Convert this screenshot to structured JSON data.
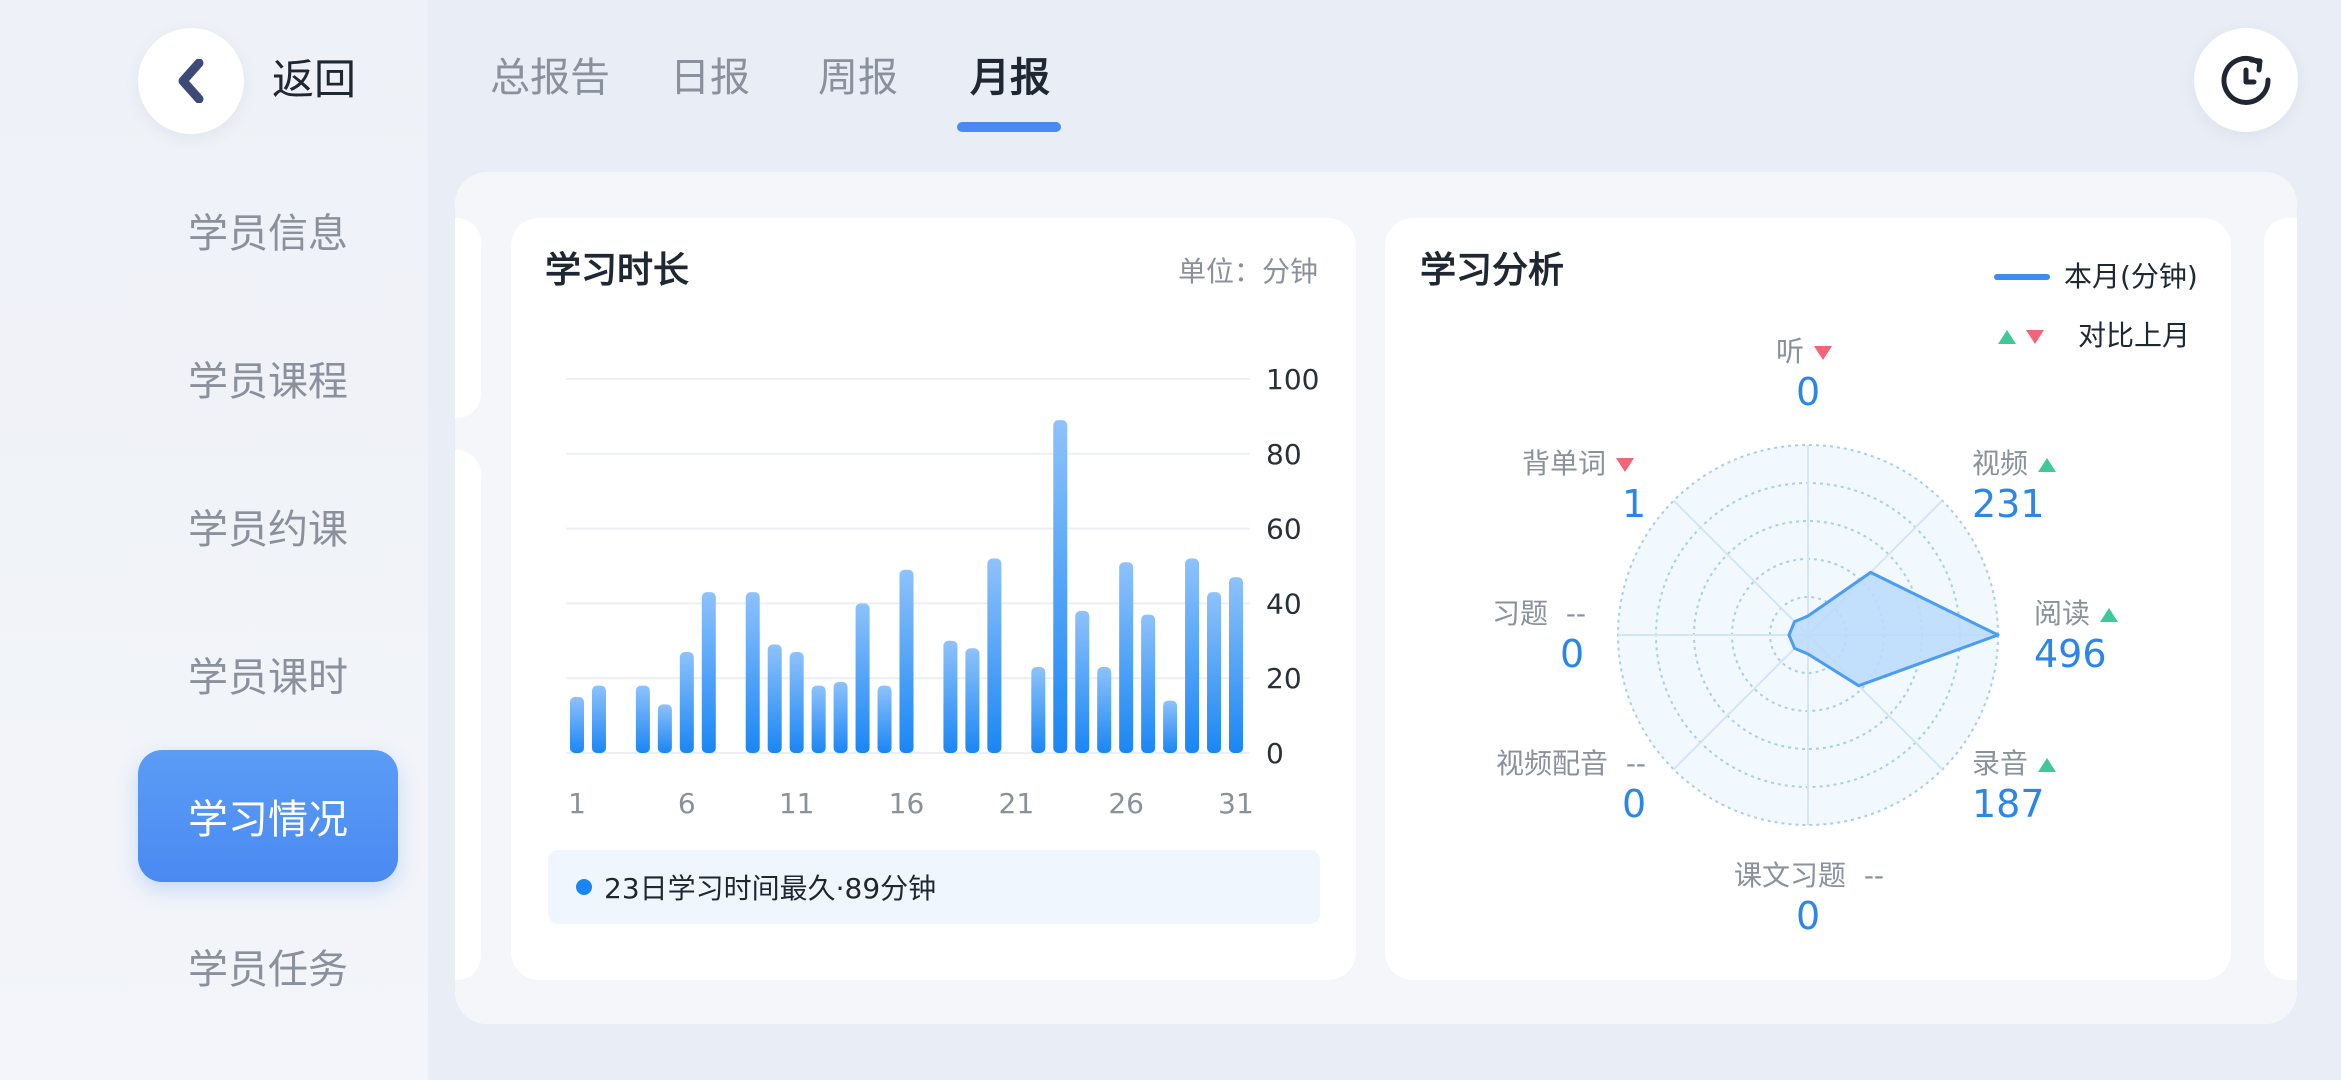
{
  "sidebar": {
    "back_label": "返回",
    "items": [
      {
        "label": "学员信息",
        "active": false
      },
      {
        "label": "学员课程",
        "active": false
      },
      {
        "label": "学员约课",
        "active": false
      },
      {
        "label": "学员课时",
        "active": false
      },
      {
        "label": "学习情况",
        "active": true
      },
      {
        "label": "学员任务",
        "active": false
      }
    ]
  },
  "tabs": [
    {
      "label": "总报告",
      "active": false
    },
    {
      "label": "日报",
      "active": false
    },
    {
      "label": "周报",
      "active": false
    },
    {
      "label": "月报",
      "active": true
    }
  ],
  "study_duration": {
    "title": "学习时长",
    "unit": "单位：分钟",
    "highlight": "23日学习时间最久·89分钟",
    "chart_data": {
      "type": "bar",
      "categories": [
        1,
        2,
        3,
        4,
        5,
        6,
        7,
        8,
        9,
        10,
        11,
        12,
        13,
        14,
        15,
        16,
        17,
        18,
        19,
        20,
        21,
        22,
        23,
        24,
        25,
        26,
        27,
        28,
        29,
        30,
        31
      ],
      "x_tick_labels": [
        "1",
        "6",
        "11",
        "16",
        "21",
        "26",
        "31"
      ],
      "values": [
        15,
        18,
        0,
        18,
        13,
        27,
        43,
        0,
        43,
        29,
        27,
        18,
        19,
        40,
        18,
        49,
        0,
        30,
        28,
        52,
        0,
        23,
        89,
        38,
        23,
        51,
        37,
        14,
        52,
        43,
        47
      ],
      "y_ticks": [
        0,
        20,
        40,
        60,
        80,
        100
      ],
      "ylim": [
        0,
        100
      ],
      "grid": true,
      "ylabel_position": "right",
      "colors": {
        "bar_top": "#8ec2fb",
        "bar_bottom": "#1a86f4",
        "grid": "#eceff4",
        "axis_text": "#2a2f3a",
        "x_text": "#8a909c"
      }
    }
  },
  "study_analysis": {
    "title": "学习分析",
    "legend": {
      "series_label": "本月(分钟)",
      "compare_label": "对比上月"
    },
    "chart_data": {
      "type": "radar",
      "series": [
        {
          "name": "本月(分钟)",
          "values": [
            0,
            231,
            496,
            187,
            0,
            0,
            0,
            1
          ]
        }
      ],
      "axes": [
        "听",
        "视频",
        "阅读",
        "录音",
        "课文习题",
        "视频配音",
        "习题",
        "背单词"
      ],
      "trends": [
        "down",
        "up",
        "up",
        "up",
        "--",
        "--",
        "--",
        "down"
      ],
      "rmax": 496,
      "rings": 5,
      "colors": {
        "fill": "#bcdcfb",
        "stroke": "#4a9cf4",
        "ring": "#a9cdee",
        "background": "#f1f8fe"
      }
    },
    "items": [
      {
        "label": "听",
        "trend": "down",
        "value": "0"
      },
      {
        "label": "视频",
        "trend": "up",
        "value": "231"
      },
      {
        "label": "阅读",
        "trend": "up",
        "value": "496"
      },
      {
        "label": "录音",
        "trend": "up",
        "value": "187"
      },
      {
        "label": "课文习题",
        "trend": "--",
        "value": "0"
      },
      {
        "label": "视频配音",
        "trend": "--",
        "value": "0"
      },
      {
        "label": "习题",
        "trend": "--",
        "value": "0"
      },
      {
        "label": "背单词",
        "trend": "down",
        "value": "1"
      }
    ]
  },
  "icons": {
    "back": "chevron-left-icon",
    "refresh": "refresh-icon"
  }
}
